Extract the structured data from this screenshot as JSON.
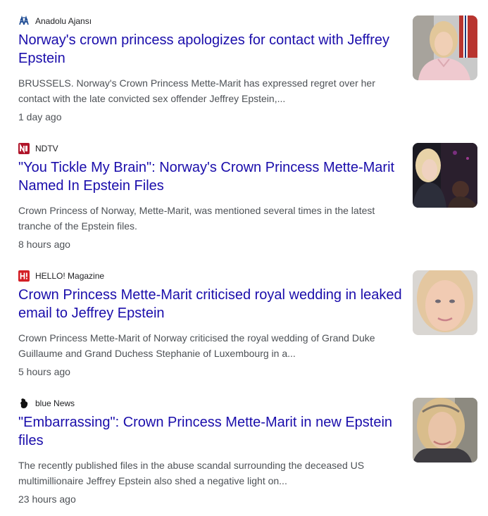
{
  "articles": [
    {
      "source": "Anadolu Ajansı",
      "source_icon": "anadolu-logo-icon",
      "headline": "Norway's crown princess apologizes for contact with Jeffrey Epstein",
      "snippet": "BRUSSELS. Norway's Crown Princess Mette-Marit has expressed regret over her contact with the late convicted sex offender Jeffrey Epstein,...",
      "time": "1 day ago",
      "thumbnail": "portrait-photo"
    },
    {
      "source": "NDTV",
      "source_icon": "ndtv-logo-icon",
      "headline": "\"You Tickle My Brain\": Norway's Crown Princess Mette-Marit Named In Epstein Files",
      "snippet": "Crown Princess of Norway, Mette-Marit, was mentioned several times in the latest tranche of the Epstein files.",
      "time": "8 hours ago",
      "thumbnail": "portrait-photo"
    },
    {
      "source": "HELLO! Magazine",
      "source_icon": "hello-magazine-logo-icon",
      "headline": "Crown Princess Mette-Marit criticised royal wedding in leaked email to Jeffrey Epstein",
      "snippet": "Crown Princess Mette-Marit of Norway criticised the royal wedding of Grand Duke Guillaume and Grand Duchess Stephanie of Luxembourg in a...",
      "time": "5 hours ago",
      "thumbnail": "portrait-photo"
    },
    {
      "source": "blue News",
      "source_icon": "blue-news-logo-icon",
      "headline": "\"Embarrassing\": Crown Princess Mette-Marit in new Epstein files",
      "snippet": "The recently published files in the abuse scandal surrounding the deceased US multimillionaire Jeffrey Epstein also shed a negative light on...",
      "time": "23 hours ago",
      "thumbnail": "portrait-photo"
    }
  ],
  "colors": {
    "headline_link": "#1a0dab",
    "body_text": "#4d5156",
    "source_text": "#202124",
    "anadolu_brand": "#1c4a93",
    "ndtv_brand": "#b0152a",
    "hello_brand": "#d31f26"
  }
}
